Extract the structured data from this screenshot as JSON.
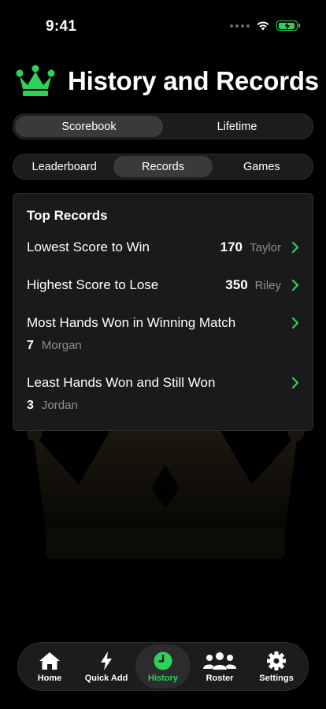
{
  "status_bar": {
    "time": "9:41"
  },
  "header": {
    "title": "History and Records"
  },
  "segments_top": [
    {
      "label": "Scorebook",
      "active": true
    },
    {
      "label": "Lifetime",
      "active": false
    }
  ],
  "segments_sub": [
    {
      "label": "Leaderboard",
      "active": false
    },
    {
      "label": "Records",
      "active": true
    },
    {
      "label": "Games",
      "active": false
    }
  ],
  "records": {
    "title": "Top Records",
    "items": [
      {
        "title": "Lowest Score to Win",
        "value": "170",
        "player": "Taylor"
      },
      {
        "title": "Highest Score to Lose",
        "value": "350",
        "player": "Riley"
      },
      {
        "title": "Most Hands Won in Winning Match",
        "value": "7",
        "player": "Morgan"
      },
      {
        "title": "Least Hands Won and Still Won",
        "value": "3",
        "player": "Jordan"
      }
    ]
  },
  "tabbar": [
    {
      "label": "Home",
      "icon": "home-icon"
    },
    {
      "label": "Quick Add",
      "icon": "bolt-icon"
    },
    {
      "label": "History",
      "icon": "clock-icon",
      "active": true
    },
    {
      "label": "Roster",
      "icon": "people-icon"
    },
    {
      "label": "Settings",
      "icon": "gear-icon"
    }
  ],
  "colors": {
    "accent": "#30d158",
    "background": "#000000",
    "card": "#1c1c1e"
  }
}
